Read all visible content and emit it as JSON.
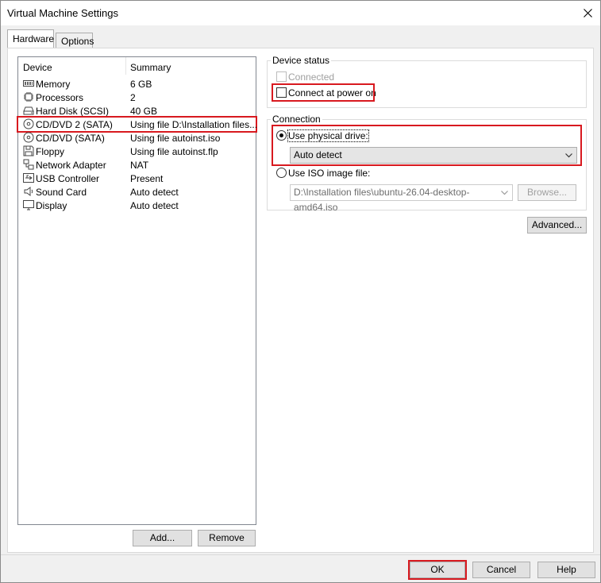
{
  "window": {
    "title": "Virtual Machine Settings"
  },
  "tabs": [
    {
      "label": "Hardware",
      "active": true
    },
    {
      "label": "Options",
      "active": false
    }
  ],
  "device_list": {
    "headers": {
      "device": "Device",
      "summary": "Summary"
    },
    "rows": [
      {
        "device": "Memory",
        "summary": "6 GB",
        "icon": "memory-icon"
      },
      {
        "device": "Processors",
        "summary": "2",
        "icon": "processor-icon"
      },
      {
        "device": "Hard Disk (SCSI)",
        "summary": "40 GB",
        "icon": "hard-disk-icon"
      },
      {
        "device": "CD/DVD 2 (SATA)",
        "summary": "Using file D:\\Installation files...",
        "icon": "cd-dvd-icon",
        "selected": true
      },
      {
        "device": "CD/DVD (SATA)",
        "summary": "Using file autoinst.iso",
        "icon": "cd-dvd-icon"
      },
      {
        "device": "Floppy",
        "summary": "Using file autoinst.flp",
        "icon": "floppy-icon"
      },
      {
        "device": "Network Adapter",
        "summary": "NAT",
        "icon": "network-adapter-icon"
      },
      {
        "device": "USB Controller",
        "summary": "Present",
        "icon": "usb-icon"
      },
      {
        "device": "Sound Card",
        "summary": "Auto detect",
        "icon": "speaker-icon"
      },
      {
        "device": "Display",
        "summary": "Auto detect",
        "icon": "display-icon"
      }
    ],
    "add_label": "Add...",
    "remove_label": "Remove"
  },
  "device_status": {
    "title": "Device status",
    "connected_label": "Connected",
    "connected_checked": false,
    "connect_at_power_on_label": "Connect at power on",
    "connect_at_power_on_checked": false
  },
  "connection": {
    "title": "Connection",
    "physical_drive_label": "Use physical drive:",
    "physical_drive_selected": true,
    "physical_drive_value": "Auto detect",
    "iso_label": "Use ISO image file:",
    "iso_selected": false,
    "iso_path": "D:\\Installation files\\ubuntu-26.04-desktop-amd64.iso",
    "browse_label": "Browse..."
  },
  "advanced_label": "Advanced...",
  "footer": {
    "ok_label": "OK",
    "cancel_label": "Cancel",
    "help_label": "Help"
  },
  "colors": {
    "highlight_box": "#d8191f",
    "tab_panel_bg": "#ffffff",
    "dialog_bg": "#f0f0f0"
  }
}
